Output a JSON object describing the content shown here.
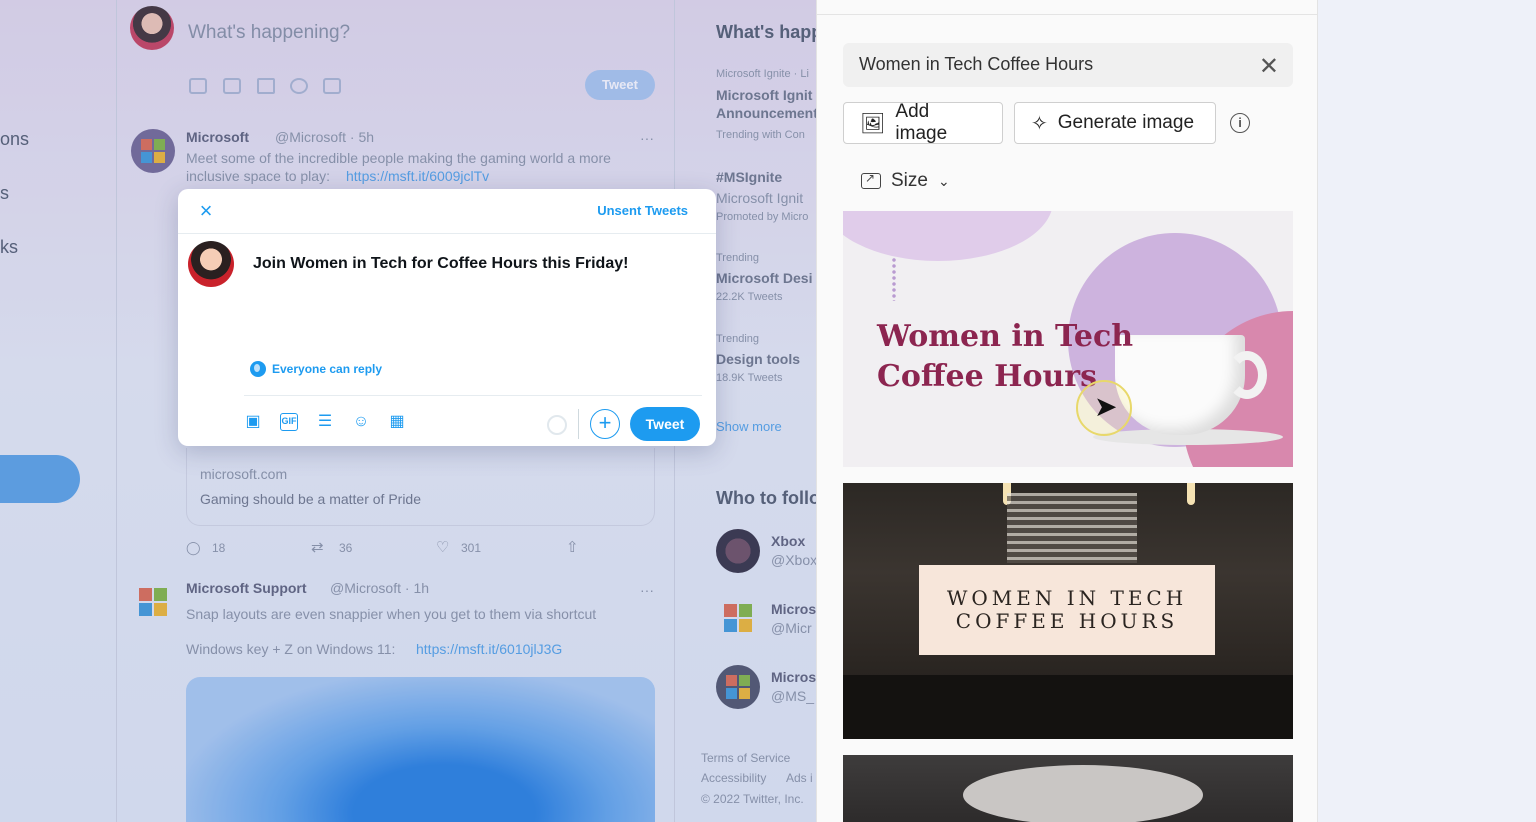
{
  "background": {
    "compose_placeholder": "What's happening?",
    "tweet_button": "Tweet",
    "nav_fragments": [
      "ons",
      "s",
      "ks"
    ],
    "tweets": [
      {
        "author": "Microsoft",
        "handle": "@Microsoft · 5h",
        "text": "Meet some of the incredible people making the gaming world a more",
        "text2": "inclusive space to play:",
        "link": "https://msft.it/6009jclTv"
      },
      {
        "card_domain": "microsoft.com",
        "card_title": "Gaming should be a matter of Pride",
        "replies": "18",
        "retweets": "36",
        "likes": "301"
      },
      {
        "author": "Microsoft Support",
        "handle": "@Microsoft · 1h",
        "text": "Snap layouts are even snappier when you get to them via shortcut",
        "text2": "Windows key + Z on Windows 11:",
        "link": "https://msft.it/6010jlJ3G"
      }
    ],
    "trends": {
      "header": "What's happ",
      "items": [
        {
          "meta": "Microsoft Ignite · Li",
          "title": "Microsoft Ignit",
          "title2": "Announcement",
          "extra": "Trending with Con"
        },
        {
          "meta": "",
          "title": "#MSIgnite",
          "title2": "Microsoft Ignit",
          "extra": "Promoted by Micro"
        },
        {
          "meta": "Trending",
          "title": "Microsoft Desi",
          "extra": "22.2K Tweets"
        },
        {
          "meta": "Trending",
          "title": "Design tools",
          "extra": "18.9K Tweets"
        }
      ],
      "show_more": "Show more"
    },
    "who_to_follow": {
      "header": "Who to follo",
      "accounts": [
        {
          "name": "Xbox",
          "handle": "@Xbox"
        },
        {
          "name": "Micros",
          "handle": "@Micr"
        },
        {
          "name": "Micros",
          "handle": "@MS_"
        }
      ]
    },
    "footer": [
      "Terms of Service",
      "Accessibility",
      "Ads i",
      "© 2022 Twitter, Inc."
    ]
  },
  "compose": {
    "unsent_label": "Unsent Tweets",
    "text": "Join Women in Tech for Coffee Hours this Friday!",
    "reply_setting": "Everyone can reply",
    "tweet_button": "Tweet"
  },
  "designer": {
    "search_value": "Women in Tech Coffee Hours",
    "add_image": "Add image",
    "generate_image": "Generate image",
    "size_label": "Size",
    "results": [
      {
        "title_line1": "Women in Tech",
        "title_line2": "Coffee Hours"
      },
      {
        "title_line1": "WOMEN IN TECH",
        "title_line2": "COFFEE HOURS"
      }
    ]
  },
  "colors": {
    "twitter_blue": "#1d9bf0",
    "card1_title": "#8c2550"
  }
}
